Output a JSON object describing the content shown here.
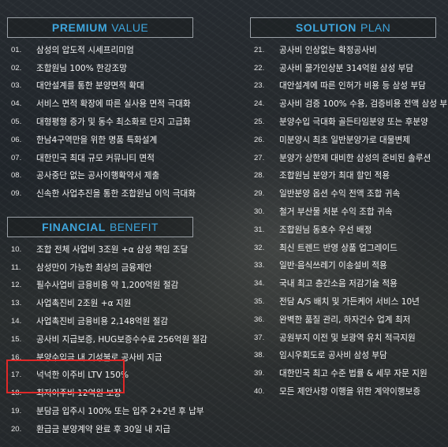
{
  "premium": {
    "title_bold": "PREMIUM",
    "title_light": "VALUE",
    "items": [
      {
        "num": "01.",
        "text": "삼성의 압도적 시세프리미엄"
      },
      {
        "num": "02.",
        "text": "조합원님 100% 한강조망"
      },
      {
        "num": "03.",
        "text": "대안설계를 통한 분양면적 확대"
      },
      {
        "num": "04.",
        "text": "서비스 면적 확장에 따른 실사용 면적 극대화"
      },
      {
        "num": "05.",
        "text": "대형평형 증가 및 동수 최소화로 단지 고급화"
      },
      {
        "num": "06.",
        "text": "한남4구역만을 위한 명품 특화설계"
      },
      {
        "num": "07.",
        "text": "대한민국 최대 규모 커뮤니티 면적"
      },
      {
        "num": "08.",
        "text": "공사중단 없는 공사이행확약서 제출"
      },
      {
        "num": "09.",
        "text": "신속한 사업추진을 통한 조합원님 이익 극대화"
      }
    ]
  },
  "financial": {
    "title_bold": "FINANCIAL",
    "title_light": "BENEFIT",
    "items": [
      {
        "num": "10.",
        "text": "조합 전체 사업비 3조원 +α 삼성 책임 조달"
      },
      {
        "num": "11.",
        "text": "삼성만이 가능한 최상의 금융제안"
      },
      {
        "num": "12.",
        "text": "필수사업비 금융비용 약 1,200억원 절감"
      },
      {
        "num": "13.",
        "text": "사업촉진비 2조원 +α 지원"
      },
      {
        "num": "14.",
        "text": "사업촉진비 금융비용 2,148억원 절감"
      },
      {
        "num": "15.",
        "text": "공사비 지급보증, HUG보증수수료 256억원 절감"
      },
      {
        "num": "16.",
        "text": "분양수입금 내 기성불로 공사비 지급"
      },
      {
        "num": "17.",
        "text": "넉넉한 이주비 LTV 150%"
      },
      {
        "num": "18.",
        "text": "최저이주비 12억원 보장"
      },
      {
        "num": "19.",
        "text": "분담금 입주시 100% 또는 입주 2+2년 후 납부"
      },
      {
        "num": "20.",
        "text": "환급금 분양계약 완료 후 30일 내 지급"
      }
    ]
  },
  "solution": {
    "title_bold": "SOLUTION",
    "title_light": "PLAN",
    "items": [
      {
        "num": "21.",
        "text": "공사비 인상없는 확정공사비"
      },
      {
        "num": "22.",
        "text": "공사비 물가인상분 314억원 삼성 부담"
      },
      {
        "num": "23.",
        "text": "대안설계에 따른 인허가 비용 등 삼성 부담"
      },
      {
        "num": "24.",
        "text": "공사비 검증 100% 수용, 검증비용 전액 삼성 부담"
      },
      {
        "num": "25.",
        "text": "분양수입 극대화 골든타임분양 또는 후분양"
      },
      {
        "num": "26.",
        "text": "미분양시 최초 일반분양가로 대물변제"
      },
      {
        "num": "27.",
        "text": "분양가 상한제 대비한 삼성의 준비된 솔루션"
      },
      {
        "num": "28.",
        "text": "조합원님 분양가 최대 할인 적용"
      },
      {
        "num": "29.",
        "text": "일반분양 옵션 수익 전액 조합 귀속"
      },
      {
        "num": "30.",
        "text": "철거 부산물 처분 수익 조합 귀속"
      },
      {
        "num": "31.",
        "text": "조합원님 동호수 우선 배정"
      },
      {
        "num": "32.",
        "text": "최신 트렌드 반영 상품 업그레이드"
      },
      {
        "num": "33.",
        "text": "일반·음식쓰레기 이송설비 적용"
      },
      {
        "num": "34.",
        "text": "국내 최고 층간소음 저감기술 적용"
      },
      {
        "num": "35.",
        "text": "전담 A/S 배치 및 가든케어 서비스 10년"
      },
      {
        "num": "36.",
        "text": "완벽한 품질 관리, 하자건수 업계 최저"
      },
      {
        "num": "37.",
        "text": "공원부지 이전 및 보광역 유치 적극지원"
      },
      {
        "num": "38.",
        "text": "임시우회도로 공사비 삼성 부담"
      },
      {
        "num": "39.",
        "text": "대한민국 최고 수준 법률 & 세무 자문 지원"
      },
      {
        "num": "40.",
        "text": "모든 제안사항 이행을 위한 계약이행보증"
      }
    ]
  },
  "colors": {
    "accent": "#3fa6dd",
    "highlight": "#e02828"
  }
}
